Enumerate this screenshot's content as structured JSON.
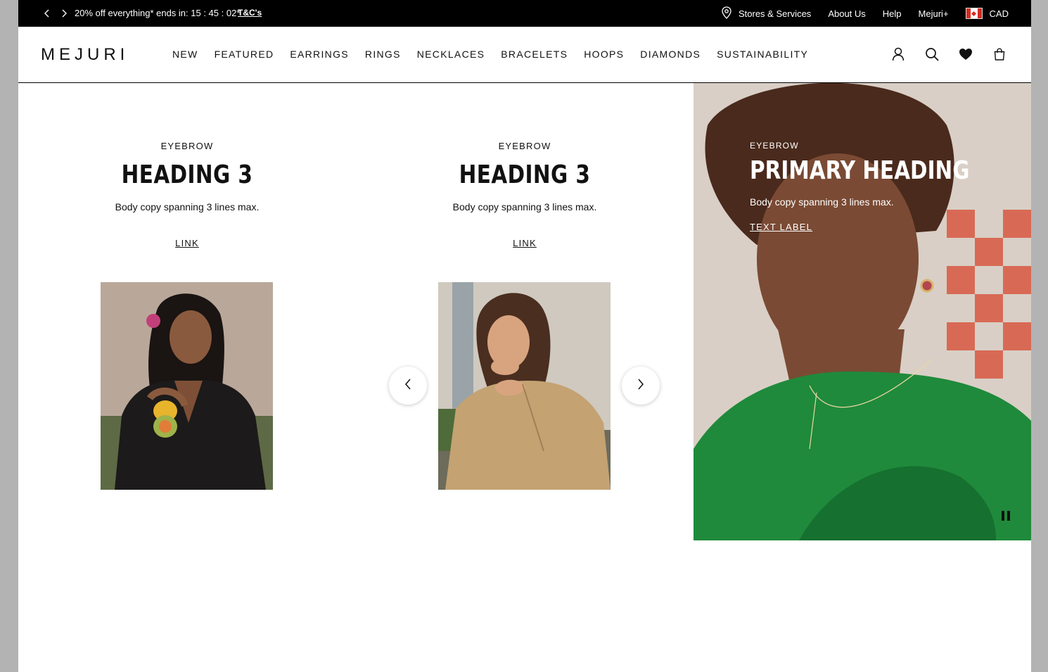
{
  "promo": {
    "message": "20% off everything* ends in: 15 : 45 : 02*",
    "terms_link": "T&C's",
    "right_links": [
      "Stores & Services",
      "About Us",
      "Help",
      "Mejuri+"
    ],
    "currency": "CAD"
  },
  "nav": {
    "logo": "MEJURI",
    "menu": [
      "NEW",
      "FEATURED",
      "EARRINGS",
      "RINGS",
      "NECKLACES",
      "BRACELETS",
      "HOOPS",
      "DIAMONDS",
      "SUSTAINABILITY"
    ]
  },
  "cards": [
    {
      "eyebrow": "EYEBROW",
      "heading": "HEADING 3",
      "body": "Body copy spanning 3 lines max.",
      "link": "LINK"
    },
    {
      "eyebrow": "EYEBROW",
      "heading": "HEADING 3",
      "body": "Body copy spanning 3 lines max.",
      "link": "LINK"
    }
  ],
  "hero": {
    "eyebrow": "EYEBROW",
    "heading": "PRIMARY HEADING",
    "body": "Body copy spanning 3 lines max.",
    "label": "TEXT LABEL"
  },
  "colors": {
    "promo_bg": "#000000",
    "text": "#111111",
    "accent_green": "#1f8a3b"
  }
}
